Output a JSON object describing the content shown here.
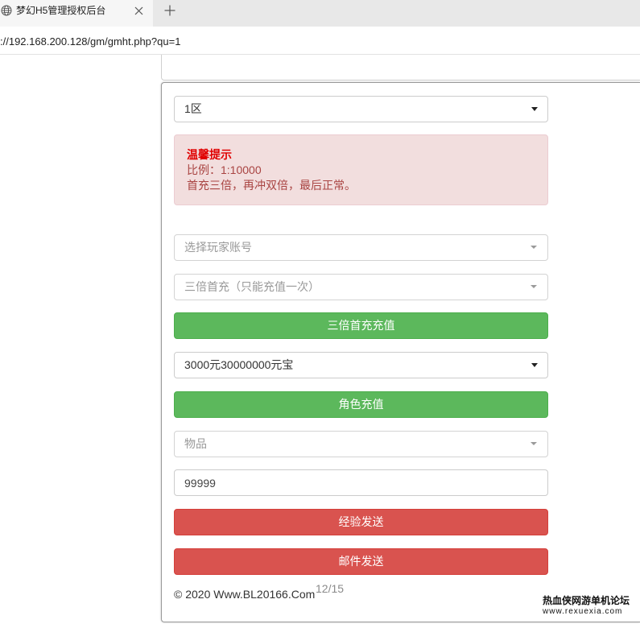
{
  "browser": {
    "tab_title": "梦幻H5管理授权后台",
    "address": "://192.168.200.128/gm/gmht.php?qu=1"
  },
  "form": {
    "zone_select": "1区",
    "notice": {
      "title": "温馨提示",
      "ratio": "比例：1:10000",
      "desc": "首充三倍，再冲双倍，最后正常。"
    },
    "account_select": "选择玩家账号",
    "first_charge_select": "三倍首充（只能充值一次）",
    "first_charge_button": "三倍首充充值",
    "amount_select": "3000元30000000元宝",
    "role_charge_button": "角色充值",
    "item_select": "物品",
    "quantity_input": "99999",
    "exp_send_button": "经验发送",
    "mail_send_button": "邮件发送"
  },
  "footer": {
    "copyright": "© 2020 Www.BL20166.Com",
    "page_counter": "12/15"
  },
  "watermark": {
    "line1": "热血侠网游单机论坛",
    "line2": "www.rexuexia.com"
  },
  "colors": {
    "success": "#5cb85c",
    "success_border": "#4cae4c",
    "danger": "#d9534f",
    "danger_border": "#d43f3a",
    "alert_bg": "#f2dede",
    "alert_border": "#ebccd1",
    "alert_title": "#e00000",
    "alert_text": "#a94442"
  },
  "icons": {
    "tab_favicon": "globe-icon",
    "tab_close": "close-icon",
    "new_tab": "plus-icon",
    "select_arrow": "caret-down-icon"
  }
}
